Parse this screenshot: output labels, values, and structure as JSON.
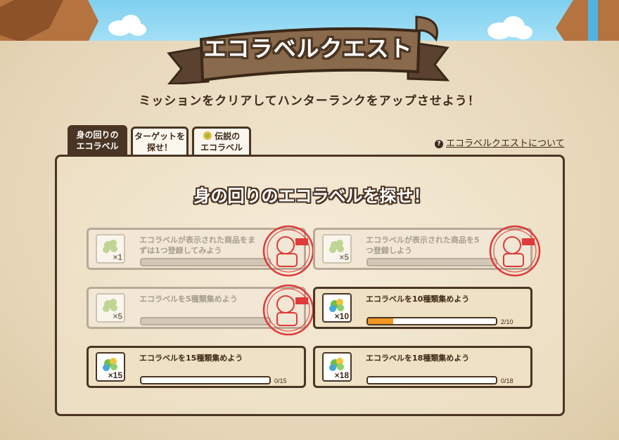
{
  "header": {
    "title": "エコラベルクエスト"
  },
  "subtitle": "ミッションをクリアしてハンターランクをアップさせよう！",
  "tabs": [
    {
      "label_line1": "身の回りの",
      "label_line2": "エコラベル",
      "active": true
    },
    {
      "label_line1": "ターゲットを",
      "label_line2": "探せ！",
      "active": false
    },
    {
      "label_line1": "伝説の",
      "label_line2": "エコラベル",
      "active": false,
      "icon": "leaf-badge-icon"
    }
  ],
  "about_link": {
    "label": "エコラベルクエストについて",
    "icon": "question-icon"
  },
  "panel": {
    "title": "身の回りのエコラベルを探せ！"
  },
  "colors": {
    "accent": "#f19524",
    "dark_brown": "#4a3524",
    "stamp_red": "#e03a3a"
  },
  "missions": [
    {
      "text": "エコラベルが表示された商品をまずは1つ登録してみよう",
      "multiplier": "×1",
      "completed": true,
      "progress_fraction": 1,
      "progress_text": ""
    },
    {
      "text": "エコラベルが表示された商品を5つ登録しよう",
      "multiplier": "×5",
      "completed": true,
      "progress_fraction": 1,
      "progress_text": ""
    },
    {
      "text": "エコラベルを5種類集めよう",
      "multiplier": "×5",
      "completed": true,
      "progress_fraction": 1,
      "progress_text": ""
    },
    {
      "text": "エコラベルを10種類集めよう",
      "multiplier": "×10",
      "completed": false,
      "progress_fraction": 0.2,
      "progress_text": "2/10"
    },
    {
      "text": "エコラベルを15種類集めよう",
      "multiplier": "×15",
      "completed": false,
      "progress_fraction": 0,
      "progress_text": "0/15"
    },
    {
      "text": "エコラベルを18種類集めよう",
      "multiplier": "×18",
      "completed": false,
      "progress_fraction": 0,
      "progress_text": "0/18"
    }
  ]
}
